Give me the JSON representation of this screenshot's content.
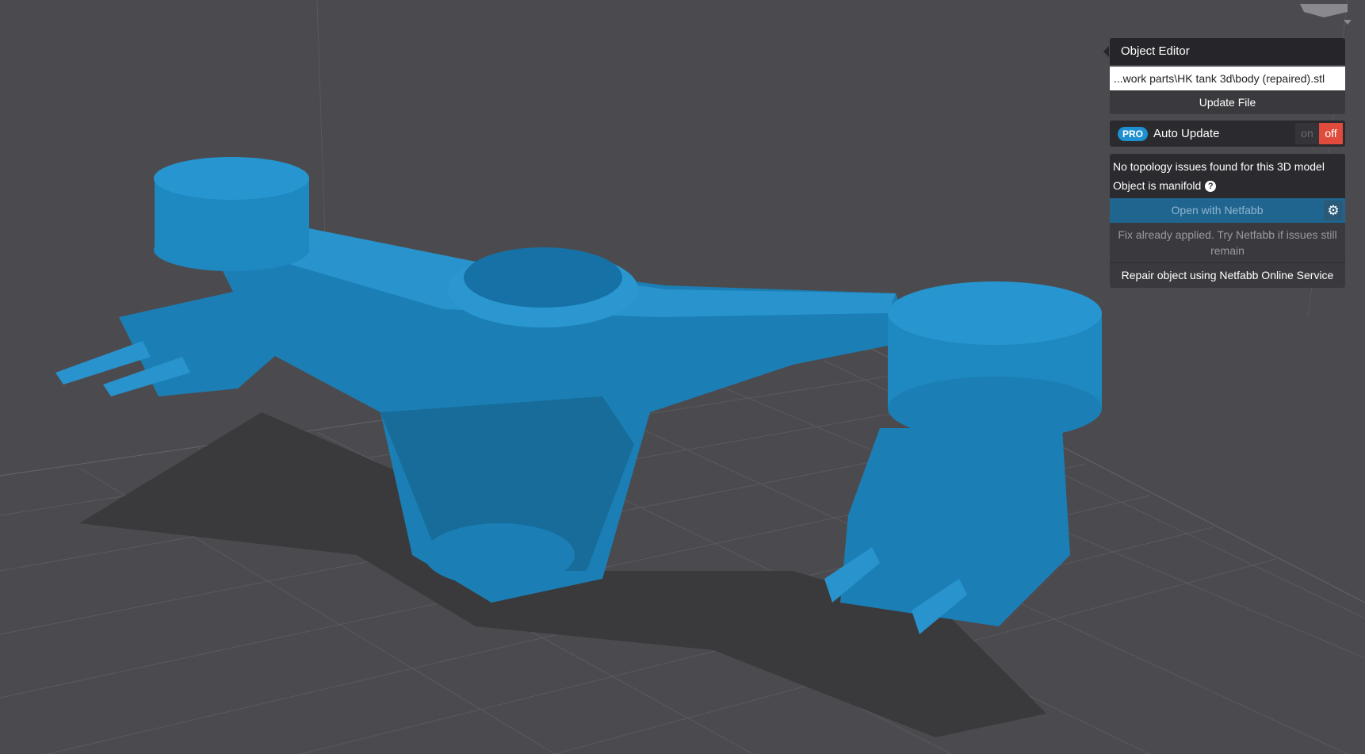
{
  "panel": {
    "title": "Object Editor",
    "file_path": "...work parts\\HK tank 3d\\body (repaired).stl",
    "update_file": "Update File",
    "pro_badge": "PRO",
    "auto_update": "Auto Update",
    "toggle_on": "on",
    "toggle_off": "off",
    "auto_update_state": "off",
    "topology_status": "No topology issues found for this 3D model",
    "manifold_status": "Object is manifold",
    "help_glyph": "?",
    "open_netfabb": "Open with Netfabb",
    "fix_note": "Fix already applied. Try Netfabb if issues still remain",
    "repair_online": "Repair object using Netfabb Online Service"
  },
  "colors": {
    "background": "#4b4b4f",
    "model": "#1e88c0",
    "accent": "#1e8fd0",
    "off": "#e04b3b"
  }
}
